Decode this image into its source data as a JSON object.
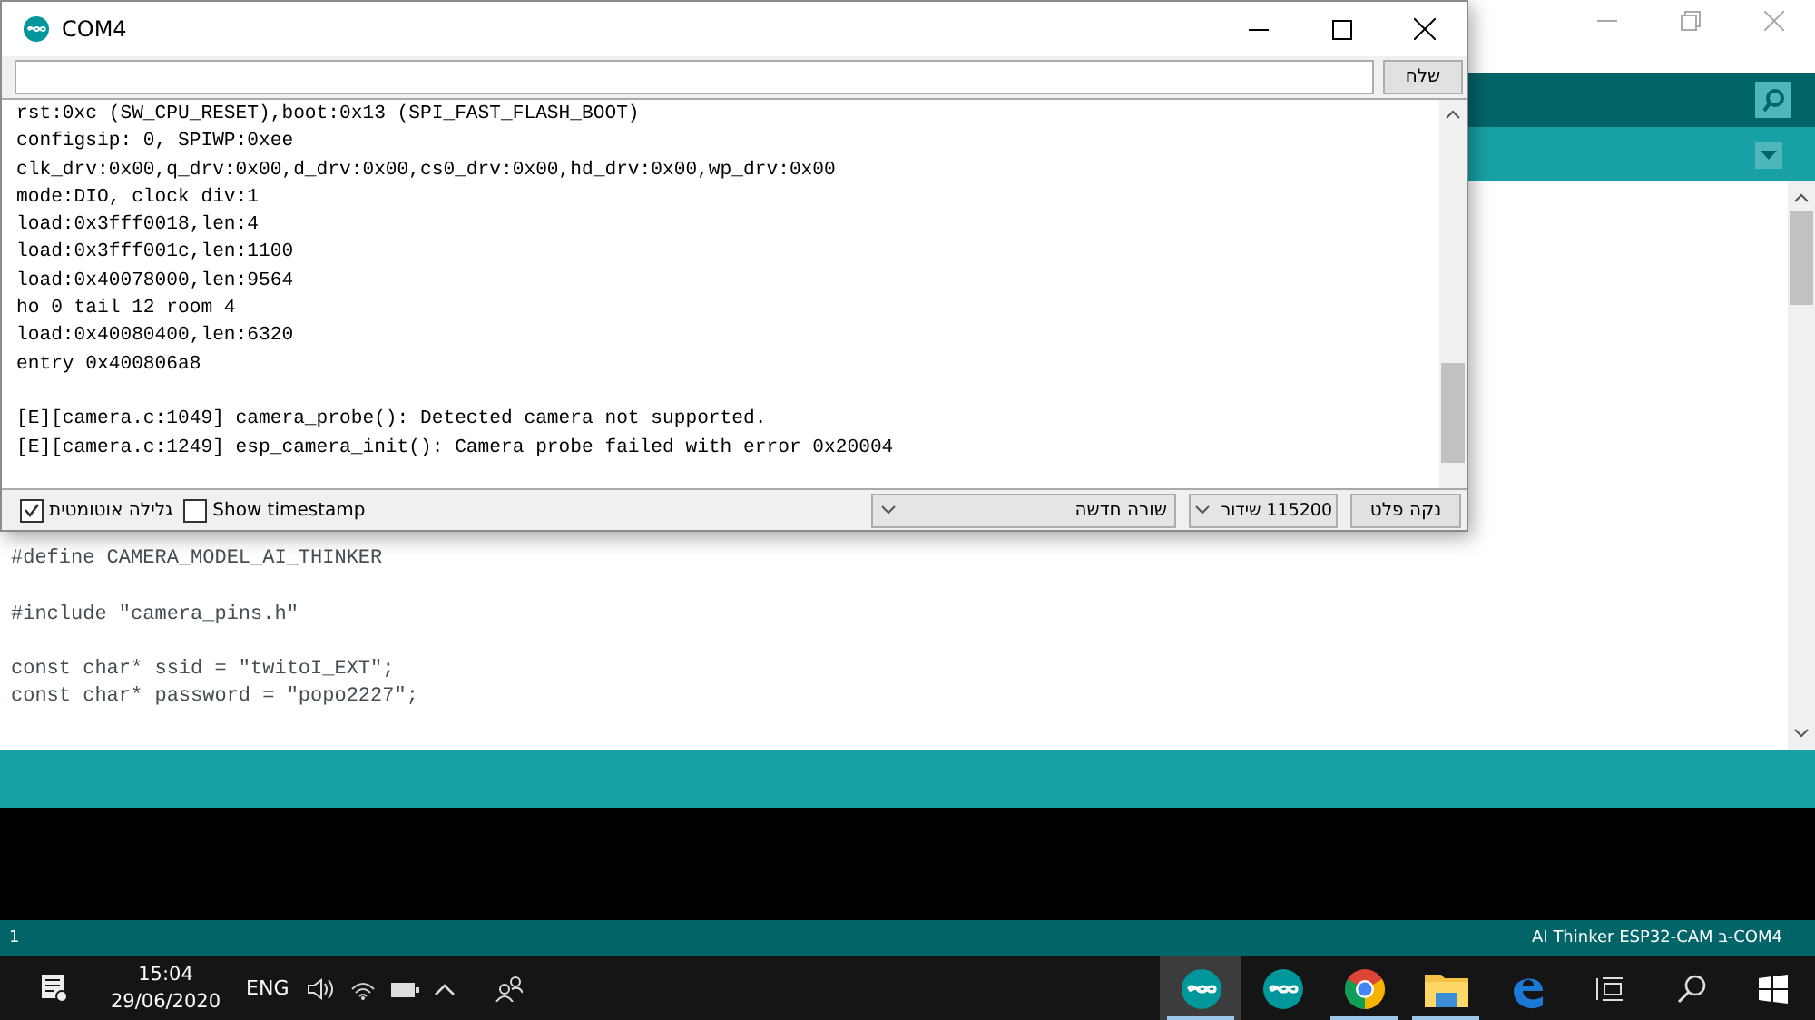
{
  "editor": {
    "code_blocks": [
      [
        "#define CAMERA_MODEL_AI_THINKER"
      ],
      [
        "#include \"camera_pins.h\""
      ],
      [
        "const char* ssid = \"twitoI_EXT\";",
        "const char* password = \"popo2227\";"
      ]
    ]
  },
  "status_bar": {
    "line": "1",
    "board": "AI Thinker ESP32-CAM ב-COM4"
  },
  "serial_monitor": {
    "title": "COM4",
    "send_button": "שלח",
    "output_blocks": [
      [
        "rst:0xc (SW_CPU_RESET),boot:0x13 (SPI_FAST_FLASH_BOOT)",
        "configsip: 0, SPIWP:0xee",
        "clk_drv:0x00,q_drv:0x00,d_drv:0x00,cs0_drv:0x00,hd_drv:0x00,wp_drv:0x00",
        "mode:DIO, clock div:1",
        "load:0x3fff0018,len:4",
        "load:0x3fff001c,len:1100",
        "load:0x40078000,len:9564",
        "ho 0 tail 12 room 4",
        "load:0x40080400,len:6320",
        "entry 0x400806a8"
      ],
      [
        "[E][camera.c:1049] camera_probe(): Detected camera not supported.",
        "[E][camera.c:1249] esp_camera_init(): Camera probe failed with error 0x20004"
      ]
    ],
    "checkboxes": [
      {
        "label": "גלילה אוטומטית",
        "checked": true
      },
      {
        "label": "Show timestamp",
        "checked": false
      }
    ],
    "line_ending": "שורה חדשה",
    "baud_rate": "115200 שידור",
    "clear_button": "נקה פלט"
  },
  "taskbar": {
    "time": "15:04",
    "date": "29/06/2020",
    "language": "ENG",
    "apps": [
      {
        "kind": "arduino",
        "active": true,
        "running": true
      },
      {
        "kind": "arduino",
        "active": false,
        "running": false
      },
      {
        "kind": "chrome",
        "active": false,
        "running": true
      },
      {
        "kind": "folder",
        "active": false,
        "running": true
      },
      {
        "kind": "edge",
        "active": false,
        "running": false
      }
    ]
  }
}
